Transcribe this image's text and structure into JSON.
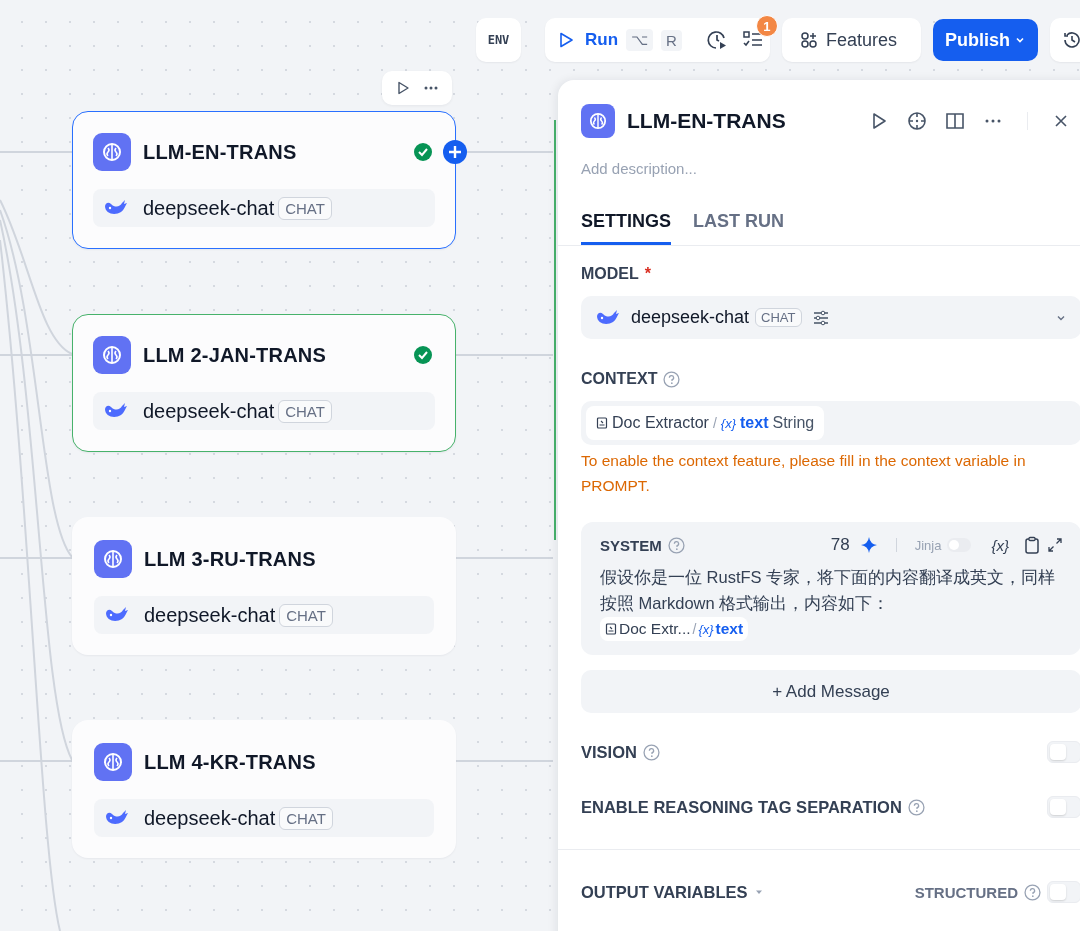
{
  "toolbar": {
    "env": "ENV",
    "run": {
      "label": "Run",
      "keys": [
        "⌥",
        "R"
      ]
    },
    "checklist_badge": "1",
    "features": "Features",
    "publish": "Publish"
  },
  "nodes": [
    {
      "title": "LLM-EN-TRANS",
      "model": "deepseek-chat",
      "mode": "CHAT",
      "selected": true,
      "succeeded": true
    },
    {
      "title": "LLM 2-JAN-TRANS",
      "model": "deepseek-chat",
      "mode": "CHAT",
      "selected": false,
      "succeeded": true
    },
    {
      "title": "LLM 3-RU-TRANS",
      "model": "deepseek-chat",
      "mode": "CHAT",
      "selected": false,
      "succeeded": false
    },
    {
      "title": "LLM 4-KR-TRANS",
      "model": "deepseek-chat",
      "mode": "CHAT",
      "selected": false,
      "succeeded": false
    }
  ],
  "panel": {
    "title": "LLM-EN-TRANS",
    "description_placeholder": "Add description...",
    "tabs": [
      {
        "label": "SETTINGS",
        "selected": true
      },
      {
        "label": "LAST RUN",
        "selected": false
      }
    ],
    "model": {
      "label": "MODEL",
      "required_mark": "*",
      "name": "deepseek-chat",
      "mode": "CHAT"
    },
    "context": {
      "label": "CONTEXT",
      "variable": {
        "node": "Doc Extractor",
        "separator": "/",
        "icon": "{x}",
        "name": "text",
        "type": "String"
      },
      "warning": "To enable the context feature, please fill in the context variable in PROMPT."
    },
    "system": {
      "label": "SYSTEM",
      "count": "78",
      "jinja": {
        "label": "Jinja",
        "on": false
      },
      "insert_variable": "{x}",
      "text": "假设你是一位 RustFS 专家，将下面的内容翻译成英文，同样按照 Markdown 格式输出，内容如下：",
      "variable": {
        "node": "Doc Extr...",
        "separator": "/",
        "icon": "{x}",
        "name": "text"
      }
    },
    "add_message": "+ Add Message",
    "toggles": [
      {
        "label": "VISION",
        "on": false
      },
      {
        "label": "ENABLE REASONING TAG SEPARATION",
        "on": false
      }
    ],
    "output": {
      "label": "OUTPUT VARIABLES",
      "structured_label": "STRUCTURED",
      "structured_on": false
    }
  }
}
